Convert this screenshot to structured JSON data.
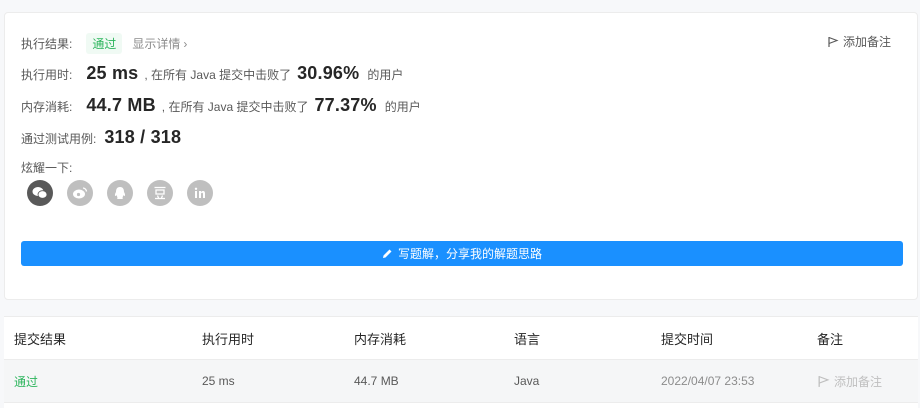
{
  "result": {
    "label": "执行结果:",
    "status": "通过",
    "details_link": "显示详情",
    "add_note": "添加备注"
  },
  "runtime": {
    "label": "执行用时:",
    "value": "25 ms",
    "beat_prefix": ", 在所有 Java 提交中击败了",
    "percent": "30.96%",
    "suffix": "的用户"
  },
  "memory": {
    "label": "内存消耗:",
    "value": "44.7 MB",
    "beat_prefix": ", 在所有 Java 提交中击败了",
    "percent": "77.37%",
    "suffix": "的用户"
  },
  "tests": {
    "label": "通过测试用例:",
    "value": "318 / 318"
  },
  "share": {
    "label": "炫耀一下:",
    "icons": [
      "wechat-icon",
      "weibo-icon",
      "qq-icon",
      "douban-icon",
      "linkedin-icon"
    ]
  },
  "write_button": "写题解，分享我的解题思路",
  "table": {
    "headers": [
      "提交结果",
      "执行用时",
      "内存消耗",
      "语言",
      "提交时间",
      "备注"
    ],
    "rows": [
      {
        "result": "通过",
        "runtime": "25 ms",
        "memory": "44.7 MB",
        "language": "Java",
        "time": "2022/04/07 23:53",
        "note": "添加备注"
      }
    ]
  },
  "colors": {
    "pass": "#2db55d",
    "primary": "#1a90ff"
  }
}
